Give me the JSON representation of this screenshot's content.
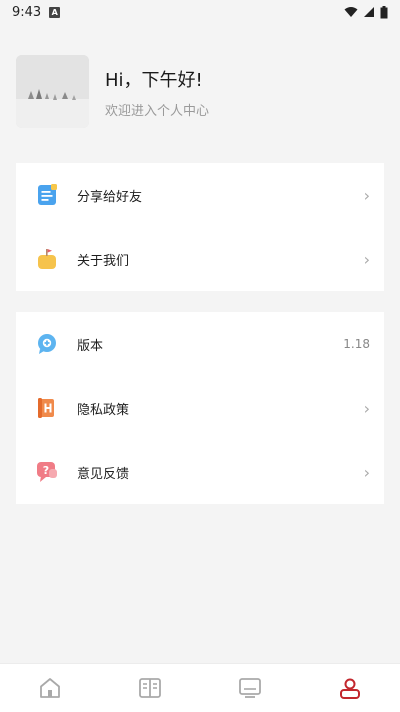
{
  "status_bar": {
    "time": "9:43",
    "notification_letter": "A"
  },
  "profile": {
    "greeting": "Hi，下午好!",
    "subtitle": "欢迎进入个人中心"
  },
  "menu_group_1": [
    {
      "label": "分享给好友",
      "icon": "share-doc-icon"
    },
    {
      "label": "关于我们",
      "icon": "about-bag-icon"
    }
  ],
  "menu_group_2": [
    {
      "label": "版本",
      "icon": "version-chat-icon",
      "value": "1.18"
    },
    {
      "label": "隐私政策",
      "icon": "privacy-h-icon"
    },
    {
      "label": "意见反馈",
      "icon": "feedback-question-icon"
    }
  ],
  "bottom_nav": [
    {
      "icon": "home-icon",
      "active": false
    },
    {
      "icon": "book-icon",
      "active": false
    },
    {
      "icon": "monitor-icon",
      "active": false
    },
    {
      "icon": "profile-icon",
      "active": true
    }
  ],
  "colors": {
    "active_nav": "#c2272d",
    "inactive_nav": "#a9a9a9",
    "background": "#f4f4f4"
  }
}
